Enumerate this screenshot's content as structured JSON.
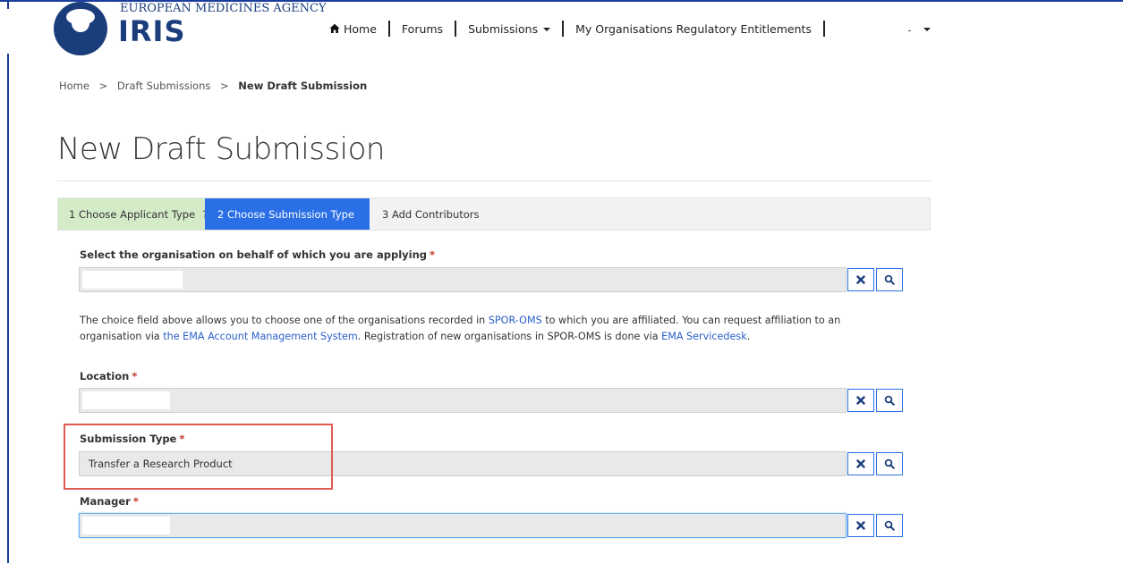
{
  "header": {
    "agency": "EUROPEAN MEDICINES AGENCY",
    "app_name": "IRIS",
    "nav": {
      "home": "Home",
      "forums": "Forums",
      "submissions": "Submissions",
      "entitlements": "My Organisations Regulatory Entitlements"
    }
  },
  "breadcrumb": {
    "home": "Home",
    "drafts": "Draft Submissions",
    "current": "New Draft Submission",
    "separator": ">"
  },
  "page_title": "New Draft Submission",
  "steps": [
    {
      "label": "1  Choose Applicant Type",
      "help": "?"
    },
    {
      "label": "2  Choose Submission Type"
    },
    {
      "label": "3  Add Contributors"
    }
  ],
  "form": {
    "organisation": {
      "label": "Select the organisation on behalf of which you are applying",
      "required": "*",
      "value": ""
    },
    "help": {
      "t1": "The choice field above allows you to choose one of the organisations recorded in ",
      "link1": "SPOR-OMS",
      "t2": " to which you are affiliated. You can request affiliation to an organisation via ",
      "link2": "the EMA Account Management System",
      "t3": ". Registration of new organisations in SPOR-OMS is done via ",
      "link3": "EMA Servicedesk",
      "t4": "."
    },
    "location": {
      "label": "Location",
      "required": "*",
      "value": ""
    },
    "submission_type": {
      "label": "Submission Type",
      "required": "*",
      "value": "Transfer a Research Product"
    },
    "manager": {
      "label": "Manager",
      "required": "*",
      "value": ""
    }
  },
  "colors": {
    "brand": "#1a3d7c",
    "active_step": "#2b6fe6",
    "done_step": "#d4ebc8",
    "highlight": "#e05a55",
    "link": "#2b5fc9"
  },
  "icons": {
    "home": "home-icon",
    "clear": "times-icon",
    "search": "search-icon"
  }
}
